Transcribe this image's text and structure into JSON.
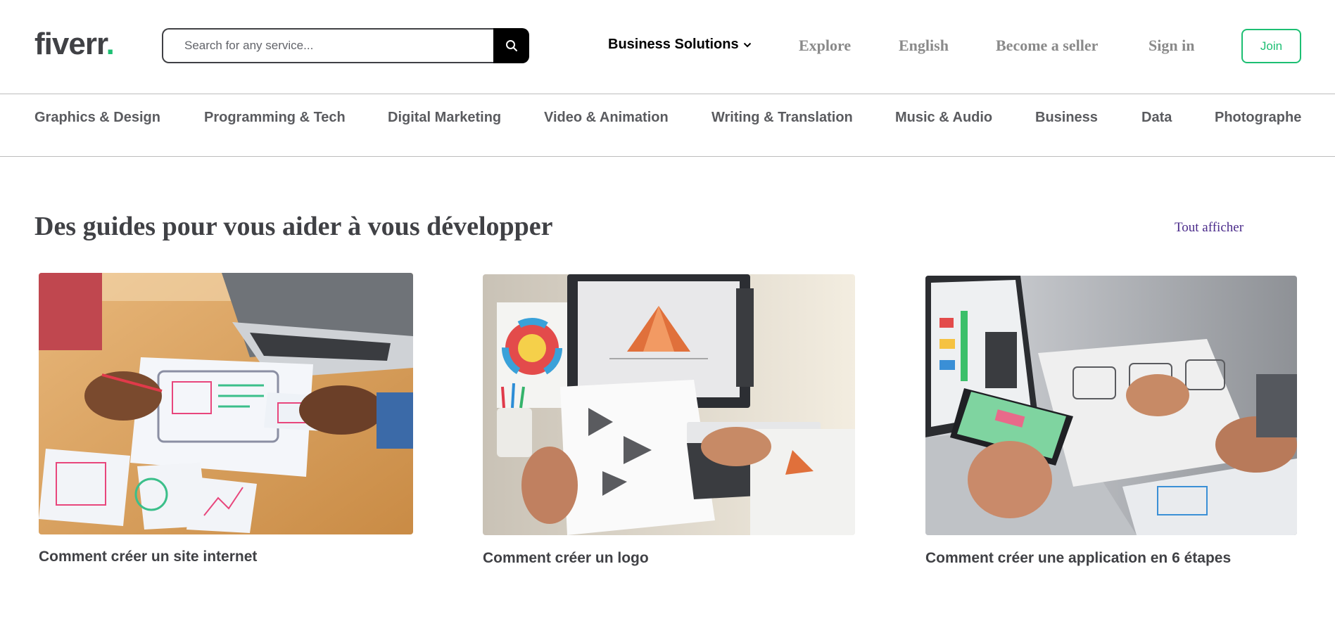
{
  "header": {
    "logo_text": "fiverr",
    "logo_dot": ".",
    "search_placeholder": "Search for any service...",
    "nav": {
      "business_solutions": "Business Solutions",
      "explore": "Explore",
      "language": "English",
      "become_seller": "Become a seller",
      "sign_in": "Sign in",
      "join": "Join"
    }
  },
  "categories": [
    "Graphics & Design",
    "Programming & Tech",
    "Digital Marketing",
    "Video & Animation",
    "Writing & Translation",
    "Music & Audio",
    "Business",
    "Data",
    "Photographe"
  ],
  "guides": {
    "title": "Des guides pour vous aider à vous développer",
    "see_all": "Tout afficher",
    "cards": [
      {
        "caption": "Comment créer un site internet"
      },
      {
        "caption": "Comment créer un logo"
      },
      {
        "caption": "Comment créer une application en 6 étapes"
      }
    ]
  },
  "colors": {
    "brand_green": "#1dbf73",
    "text_dark": "#404145",
    "link_purple": "#4a2a8a"
  }
}
